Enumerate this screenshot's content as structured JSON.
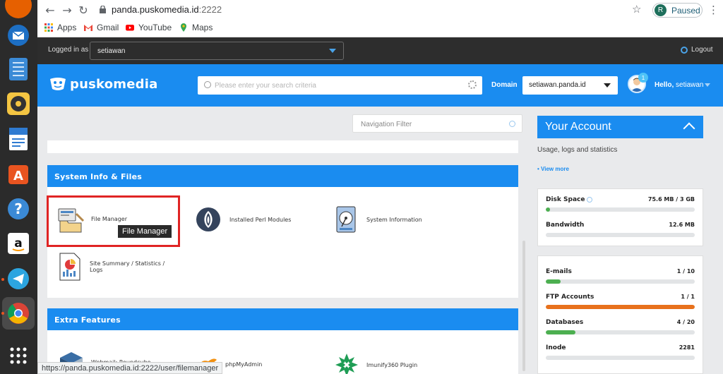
{
  "browser": {
    "url_host": "panda.puskomedia.id",
    "url_port": ":2222",
    "profile_initial": "R",
    "profile_status": "Paused",
    "bookmarks": [
      "Apps",
      "Gmail",
      "YouTube",
      "Maps"
    ],
    "status_url": "https://panda.puskomedia.id:2222/user/filemanager"
  },
  "topbar": {
    "logged_in_label": "Logged in as",
    "user": "setiawan",
    "logout": "Logout"
  },
  "header": {
    "brand": "puskomedia",
    "search_placeholder": "Please enter your search criteria",
    "domain_label": "Domain",
    "domain_value": "setiawan.panda.id",
    "notification_count": "1",
    "hello_prefix": "Hello,",
    "hello_user": "setiawan"
  },
  "main": {
    "nav_filter_placeholder": "Navigation Filter",
    "system_section": {
      "title": "System Info & Files",
      "items": [
        {
          "label": "File Manager"
        },
        {
          "label": "Installed Perl Modules"
        },
        {
          "label": "System Information"
        },
        {
          "label": "Site Summary / Statistics / Logs"
        }
      ]
    },
    "tooltip": "File Manager",
    "extra_section": {
      "title": "Extra Features",
      "items": [
        {
          "label": "Webmail: Roundcube"
        },
        {
          "label": "phpMyAdmin"
        },
        {
          "label": "Imunify360 Plugin"
        }
      ]
    }
  },
  "account": {
    "title": "Your Account",
    "subtitle": "Usage, logs and statistics",
    "view_more": "• View more",
    "stats_a": [
      {
        "label": "Disk Space",
        "value": "75.6 MB / 3 GB",
        "fill": 0.03,
        "color": "#4caf50"
      },
      {
        "label": "Bandwidth",
        "value": "12.6 MB",
        "fill": 0,
        "color": "#4caf50"
      }
    ],
    "stats_b": [
      {
        "label": "E-mails",
        "value": "1 / 10",
        "fill": 0.1,
        "color": "#4caf50"
      },
      {
        "label": "FTP Accounts",
        "value": "1 / 1",
        "fill": 1,
        "color": "#e8711c"
      },
      {
        "label": "Databases",
        "value": "4 / 20",
        "fill": 0.2,
        "color": "#4caf50"
      },
      {
        "label": "Inode",
        "value": "2281",
        "fill": 0,
        "color": "#4caf50"
      }
    ]
  }
}
